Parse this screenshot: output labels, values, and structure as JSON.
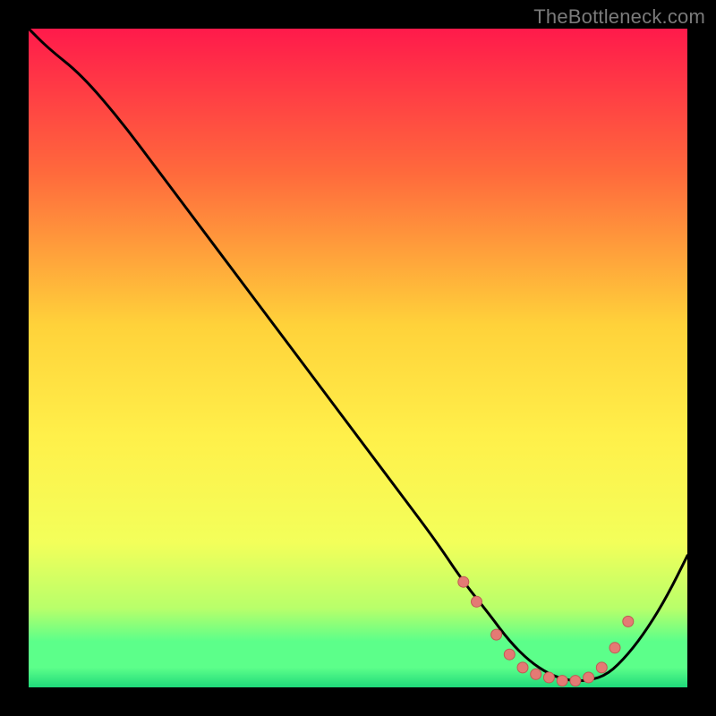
{
  "watermark": "TheBottleneck.com",
  "colors": {
    "bg": "#000000",
    "grad_top": "#ff1a4b",
    "grad_mid1": "#ff6a3c",
    "grad_mid2": "#ffd23a",
    "grad_mid3": "#fff04a",
    "grad_mid4": "#f3ff5a",
    "grad_low1": "#b8ff6a",
    "grad_low2": "#5cff8a",
    "grad_bottom": "#1fd97a",
    "curve": "#000000",
    "marker_fill": "#e47a74",
    "marker_stroke": "#c05a54"
  },
  "chart_data": {
    "type": "line",
    "title": "",
    "xlabel": "",
    "ylabel": "",
    "xlim": [
      0,
      100
    ],
    "ylim": [
      0,
      100
    ],
    "series": [
      {
        "name": "bottleneck-curve",
        "x": [
          0,
          3,
          8,
          14,
          20,
          26,
          32,
          38,
          44,
          50,
          56,
          62,
          66,
          70,
          73,
          76,
          79,
          82,
          85,
          88,
          91,
          94,
          97,
          100
        ],
        "y": [
          100,
          97,
          93,
          86,
          78,
          70,
          62,
          54,
          46,
          38,
          30,
          22,
          16,
          11,
          7,
          4,
          2,
          1,
          1,
          2,
          5,
          9,
          14,
          20
        ]
      }
    ],
    "markers": {
      "name": "highlighted-points",
      "x": [
        66,
        68,
        71,
        73,
        75,
        77,
        79,
        81,
        83,
        85,
        87,
        89,
        91
      ],
      "y": [
        16,
        13,
        8,
        5,
        3,
        2,
        1.5,
        1,
        1,
        1.5,
        3,
        6,
        10
      ]
    }
  }
}
